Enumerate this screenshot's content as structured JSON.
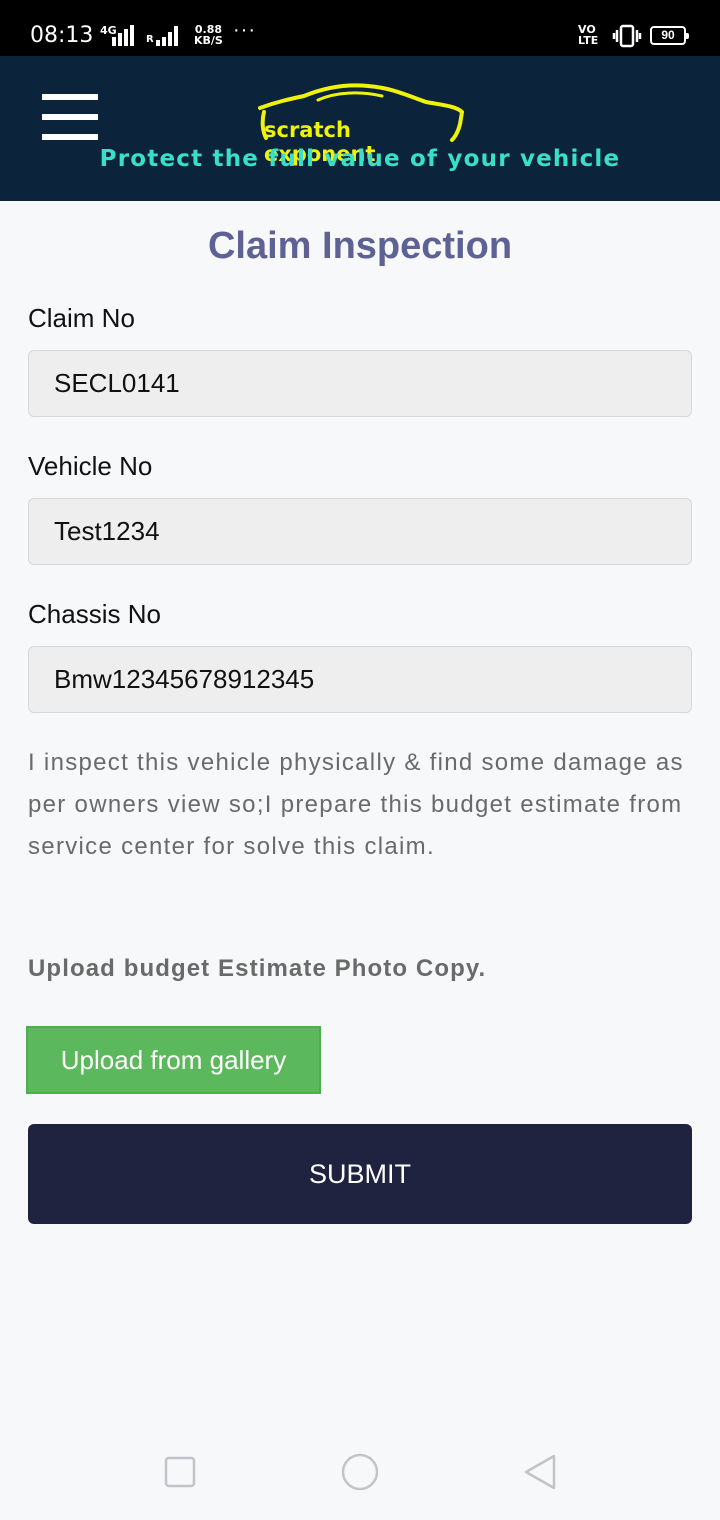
{
  "status_bar": {
    "time": "08:13",
    "network": "4G",
    "roaming": "R",
    "speed_value": "0.88",
    "speed_unit": "KB/S",
    "more": "···",
    "volte_top": "VO",
    "volte_bottom": "LTE",
    "battery": "90"
  },
  "header": {
    "logo_text": "scratch exponent",
    "tagline": "Protect the full value of your vehicle",
    "logo_color": "#f1f20c",
    "tagline_color": "#39e0c8",
    "background": "#0b233b"
  },
  "page": {
    "title": "Claim Inspection"
  },
  "form": {
    "claim_label": "Claim No",
    "claim_value": "SECL0141",
    "vehicle_label": "Vehicle No",
    "vehicle_value": "Test1234",
    "chassis_label": "Chassis No",
    "chassis_value": "Bmw12345678912345",
    "statement": "I inspect this vehicle physically & find some damage as per owners view so;I prepare this budget estimate from service center for solve this claim.",
    "upload_label": "Upload budget Estimate Photo Copy.",
    "upload_button": "Upload from gallery",
    "submit_button": "SUBMIT"
  },
  "nav_bar": {
    "icons": [
      "recent-apps-icon",
      "home-icon",
      "back-icon"
    ]
  }
}
